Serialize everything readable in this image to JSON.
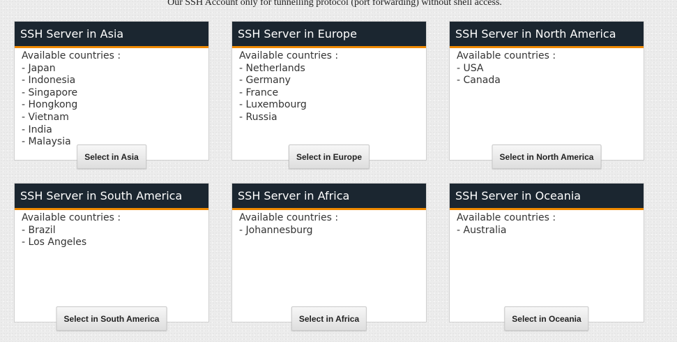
{
  "top_note": "Our SSH Account only for tunnelling protocol (port forwarding) without shell access.",
  "colors": {
    "header_bg": "#1b2630",
    "header_accent": "#f08a00",
    "card_bg": "#ffffff"
  },
  "cards": [
    {
      "title": "SSH Server in Asia",
      "countries_label": "Available countries :",
      "countries": [
        "Japan",
        "Indonesia",
        "Singapore",
        "Hongkong",
        "Vietnam",
        "India",
        "Malaysia"
      ],
      "button_label": "Select in Asia"
    },
    {
      "title": "SSH Server in Europe",
      "countries_label": "Available countries :",
      "countries": [
        "Netherlands",
        "Germany",
        "France",
        "Luxembourg",
        "Russia"
      ],
      "button_label": "Select in Europe"
    },
    {
      "title": "SSH Server in North America",
      "countries_label": "Available countries :",
      "countries": [
        "USA",
        "Canada"
      ],
      "button_label": "Select in North America"
    },
    {
      "title": "SSH Server in South America",
      "countries_label": "Available countries :",
      "countries": [
        "Brazil",
        "Los Angeles"
      ],
      "button_label": "Select in South America"
    },
    {
      "title": "SSH Server in Africa",
      "countries_label": "Available countries :",
      "countries": [
        "Johannesburg"
      ],
      "button_label": "Select in Africa"
    },
    {
      "title": "SSH Server in Oceania",
      "countries_label": "Available countries :",
      "countries": [
        "Australia"
      ],
      "button_label": "Select in Oceania"
    }
  ]
}
